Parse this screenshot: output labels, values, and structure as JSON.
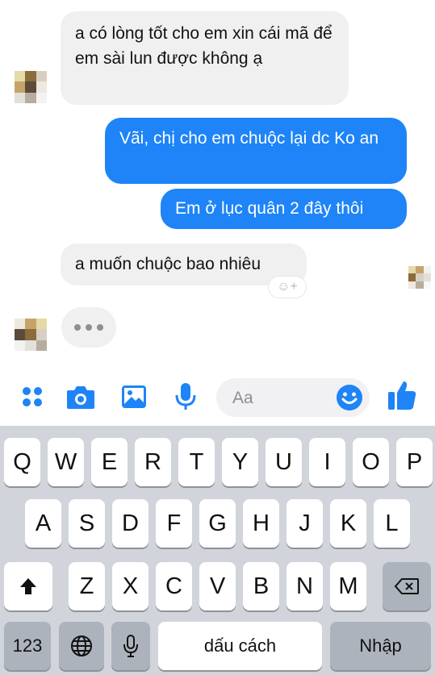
{
  "messages": [
    {
      "side": "in",
      "text": "a có lòng tốt cho em xin cái mã để em sài lun được không ạ"
    },
    {
      "side": "out",
      "text": "Vãi, chị cho em chuộc lại dc Ko an"
    },
    {
      "side": "out",
      "text": "Em ở lục quân 2 đây thôi"
    },
    {
      "side": "in",
      "text": "a muốn chuộc bao nhiêu"
    }
  ],
  "reaction": {
    "label": "☺+"
  },
  "composer": {
    "placeholder": "Aa",
    "icons": [
      "apps-icon",
      "camera-icon",
      "gallery-icon",
      "microphone-icon",
      "emoji-icon",
      "like-icon"
    ]
  },
  "keyboard": {
    "row1": [
      "Q",
      "W",
      "E",
      "R",
      "T",
      "Y",
      "U",
      "I",
      "O",
      "P"
    ],
    "row2": [
      "A",
      "S",
      "D",
      "F",
      "G",
      "H",
      "J",
      "K",
      "L"
    ],
    "row3": [
      "Z",
      "X",
      "C",
      "V",
      "B",
      "N",
      "M"
    ],
    "numbers_label": "123",
    "space_label": "dấu cách",
    "return_label": "Nhập"
  },
  "colors": {
    "accent": "#1e84f7",
    "incoming_bg": "#f0f0f1",
    "keyboard_bg": "#d1d4db"
  }
}
